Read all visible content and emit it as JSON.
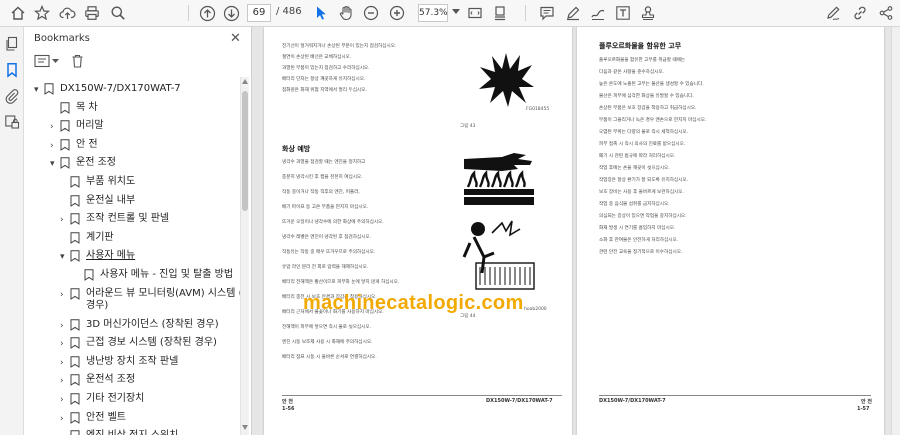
{
  "toolbar": {
    "page_current": "69",
    "page_total": "/ 486",
    "zoom": "57.3%"
  },
  "panel": {
    "title": "Bookmarks",
    "close": "✕"
  },
  "bookmarks": [
    {
      "label": "DX150W-7/DX170WAT-7",
      "level": 0,
      "chev": "▾"
    },
    {
      "label": "목 차",
      "level": 1,
      "chev": ""
    },
    {
      "label": "머리말",
      "level": 1,
      "chev": "›"
    },
    {
      "label": "안 전",
      "level": 1,
      "chev": "›"
    },
    {
      "label": "운전 조정",
      "level": 1,
      "chev": "▾"
    },
    {
      "label": "부품 위치도",
      "level": 2,
      "chev": ""
    },
    {
      "label": "운전실 내부",
      "level": 2,
      "chev": ""
    },
    {
      "label": "조작 컨트롤 및 판넬",
      "level": 2,
      "chev": "›"
    },
    {
      "label": "계기판",
      "level": 2,
      "chev": ""
    },
    {
      "label": "사용자 메뉴",
      "level": 2,
      "chev": "▾"
    },
    {
      "label": "사용자 메뉴 - 진입 및 탈출 방법",
      "level": 3,
      "chev": ""
    },
    {
      "label": "어라운드 뷰 모니터링(AVM) 시스템 (장착된",
      "label2": "경우)",
      "level": 2,
      "chev": "›"
    },
    {
      "label": "3D 머신가이던스 (장착된 경우)",
      "level": 2,
      "chev": "›"
    },
    {
      "label": "근접 경보 시스템 (장착된 경우)",
      "level": 2,
      "chev": "›"
    },
    {
      "label": "냉난방 장치 조작 판넬",
      "level": 2,
      "chev": "›"
    },
    {
      "label": "운전석 조정",
      "level": 2,
      "chev": "›"
    },
    {
      "label": "기타 전기장치",
      "level": 2,
      "chev": "›"
    },
    {
      "label": "안전 벨트",
      "level": 2,
      "chev": "›"
    },
    {
      "label": "엔진 비상 정지 스위치",
      "level": 2,
      "chev": ""
    }
  ],
  "doc": {
    "left": {
      "para1": [
        "전기선이 헐거워지거나 손상된 부분이 있는지 점검하십시오.",
        "절연이 손상된 배선은 교체하십시오.",
        "과열된 부품이 있는지 점검하고 수리하십시오.",
        "배터리 단자는 항상 깨끗하게 유지하십시오.",
        "점화원은 화재 위험 지역에서 멀리 두십시오."
      ],
      "fig1_label": "그림 43",
      "fig1_code": "FG018455",
      "heading": "화상 예방",
      "para2": [
        "냉각수 과열을 점검할 때는 엔진을 정지하고",
        "충분히 냉각시킨 후 캡을 천천히 여십시오.",
        "작동 중이거나 작동 직후의 엔진, 머플러,",
        "배기 파이프 등 고온 부품을 만지지 마십시오.",
        "뜨거운 오일이나 냉각수에 의한 화상에 주의하십시오.",
        "냉각수 레벨은 엔진이 냉각된 후 점검하십시오.",
        "작동유는 작동 중 매우 뜨거우므로 주의하십시오.",
        "유압 라인 분리 전 회로 압력을 해제하십시오.",
        "배터리 전해액은 황산이므로 피부와 눈에 닿지 않게 하십시오.",
        "배터리 충전 시 보호 안경과 장갑을 착용하십시오.",
        "배터리 근처에서 불꽃이나 화기를 사용하지 마십시오.",
        "전해액이 피부에 닿으면 즉시 물로 씻으십시오.",
        "엔진 시동 보조제 사용 시 화재에 주의하십시오.",
        "배터리 점프 시동 시 올바른 순서로 연결하십시오."
      ],
      "fig2_label": "그림 44",
      "fig2_code": "hoab2000",
      "footer_num": "1-56",
      "footer_title": "DX150W-7/DX170WAT-7",
      "footer_sec": "안 전"
    },
    "right": {
      "heading": "플루오르화물을 함유한 고무",
      "para": [
        "플루오르화물을 함유한 고무를 취급할 때에는",
        "다음과 같은 사항을 준수하십시오.",
        "높은 온도에 노출된 고무는 불산을 생성할 수 있습니다.",
        "불산은 피부에 심각한 화상을 유발할 수 있습니다.",
        "손상된 부품은 보호 장갑을 착용하고 취급하십시오.",
        "부품이 그을리거나 녹은 경우 맨손으로 만지지 마십시오.",
        "오염된 부위는 다량의 물로 즉시 세척하십시오.",
        "피부 접촉 시 즉시 의사의 진료를 받으십시오.",
        "폐기 시 관련 법규에 따라 처리하십시오.",
        "작업 후에는 손을 깨끗이 씻으십시오.",
        "작업장은 항상 환기가 잘 되도록 유지하십시오.",
        "보호 장비는 사용 후 올바르게 보관하십시오.",
        "작업 중 음식물 섭취를 금지하십시오.",
        "의심되는 증상이 있으면 작업을 중지하십시오.",
        "화재 발생 시 연기를 흡입하지 마십시오.",
        "소화 후 잔여물은 안전하게 처리하십시오.",
        "관련 안전 교육을 정기적으로 이수하십시오."
      ],
      "footer_num": "1-57",
      "footer_title": "DX150W-7/DX170WAT-7",
      "footer_sec": "안 전"
    }
  },
  "watermark": "machinecatalogic.com",
  "colors": {
    "accent": "#1473e6",
    "watermark": "#f2a900"
  }
}
